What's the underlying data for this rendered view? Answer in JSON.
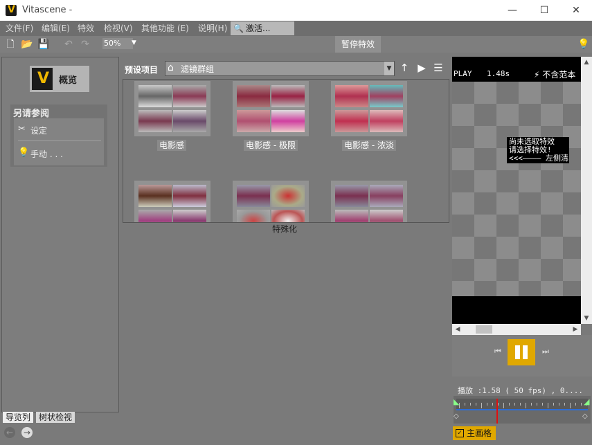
{
  "window": {
    "title": "Vitascene -",
    "logo_letter": "V",
    "minimize": "—",
    "maximize": "☐",
    "close": "✕"
  },
  "menu": {
    "items": [
      "文件(F)",
      "编辑(E)",
      "特效",
      "检视(V)",
      "其他功能 (E)",
      "说明(H)"
    ],
    "activate": "激活..."
  },
  "toolbar": {
    "zoom": "50%",
    "pause_effects": "暂停特效"
  },
  "left": {
    "overview": "概览",
    "see_also": "另请参阅",
    "links": [
      "设定",
      "手动 . . ."
    ],
    "tabs": [
      "导览列",
      "树状检视"
    ]
  },
  "presets": {
    "label": "预设项目",
    "selected": "滤镜群组",
    "tiles": [
      "电影感",
      "电影感 - 极限",
      "电影感 - 浓淡"
    ],
    "category": "特殊化"
  },
  "preview": {
    "play": "PLAY",
    "time": "1.48s",
    "no_sample": "不含范本",
    "msg1": "尚未选取特效",
    "msg2": "请选择特效!",
    "msg3": "<<<———— 左侧清单"
  },
  "status": "播放 :1.58 ( 50 fps) , 0....",
  "main_frame": "主画格",
  "colors": {
    "accent": "#e0a800",
    "timeline": "#2c6cd6",
    "playhead": "#e01010"
  }
}
